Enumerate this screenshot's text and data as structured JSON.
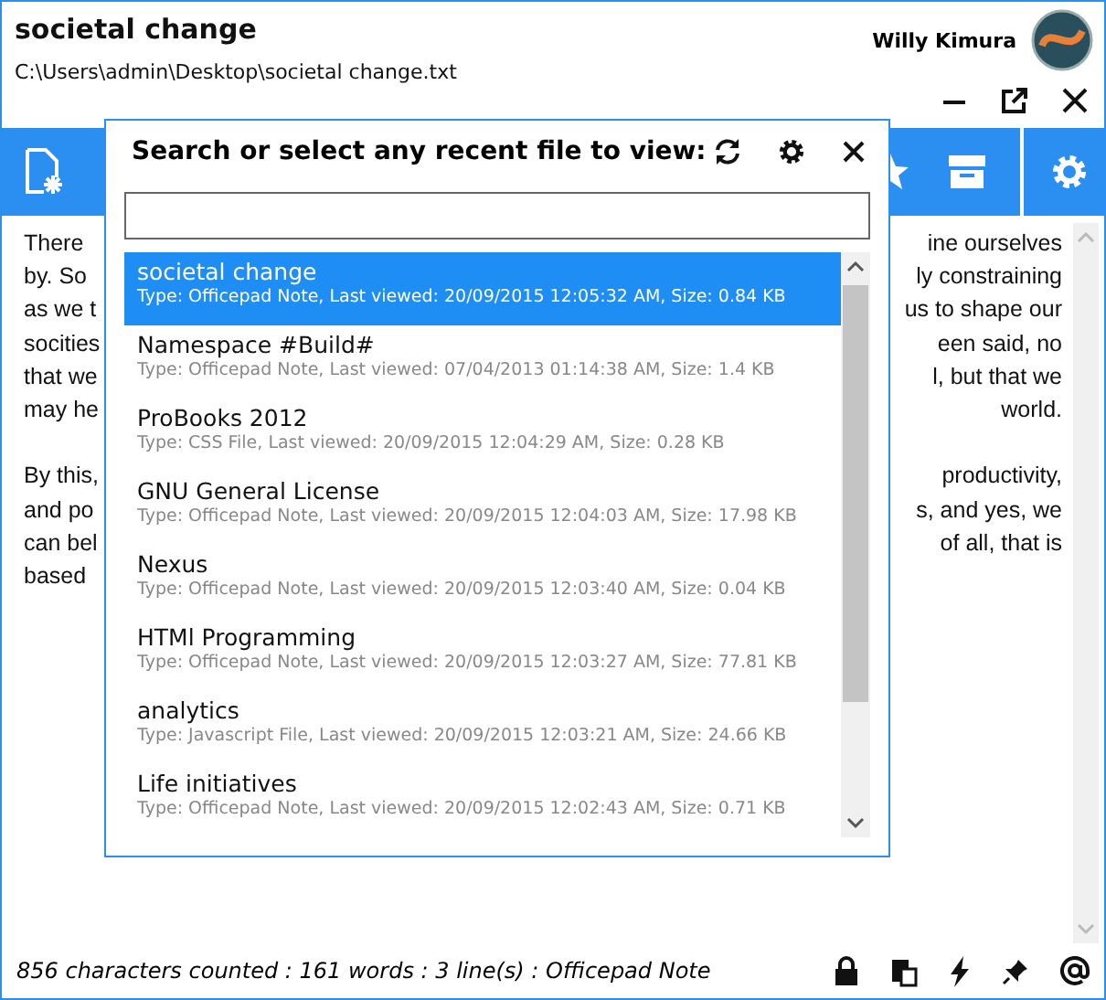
{
  "window": {
    "title": "societal change",
    "path": "C:\\Users\\admin\\Desktop\\societal change.txt",
    "user_name": "Willy Kimura"
  },
  "editor": {
    "paragraphs": [
      [
        {
          "left": "There",
          "right": "ine ourselves"
        },
        {
          "left": "by. So",
          "right": "ly constraining"
        },
        {
          "left": "as we t",
          "right": "us to shape our"
        },
        {
          "left": "socities",
          "right": "een said, no"
        },
        {
          "left": "that we",
          "right": "l, but that we"
        },
        {
          "left": "may he",
          "right": "world."
        }
      ],
      [
        {
          "left": "By this,",
          "right": "productivity,"
        },
        {
          "left": "and po",
          "right": "s, and yes, we"
        },
        {
          "left": "can bel",
          "right": "of all, that is"
        },
        {
          "left": "based"
        }
      ]
    ]
  },
  "dialog": {
    "title": "Search or select any recent file to view:",
    "files": [
      {
        "name": "societal change",
        "details": "Type: Officepad Note,  Last viewed: 20/09/2015 12:05:32 AM,  Size: 0.84 KB",
        "selected": true
      },
      {
        "name": "Namespace #Build#",
        "details": "Type: Officepad Note,  Last viewed: 07/04/2013 01:14:38 AM,  Size: 1.4 KB",
        "selected": false
      },
      {
        "name": "ProBooks 2012",
        "details": "Type: CSS File,  Last viewed: 20/09/2015 12:04:29 AM,  Size: 0.28 KB",
        "selected": false
      },
      {
        "name": "GNU General License",
        "details": "Type: Officepad Note,  Last viewed: 20/09/2015 12:04:03 AM,  Size: 17.98 KB",
        "selected": false
      },
      {
        "name": "Nexus",
        "details": "Type: Officepad Note,  Last viewed: 20/09/2015 12:03:40 AM,  Size: 0.04 KB",
        "selected": false
      },
      {
        "name": "HTMl Programming",
        "details": "Type: Officepad Note,  Last viewed: 20/09/2015 12:03:27 AM,  Size: 77.81 KB",
        "selected": false
      },
      {
        "name": "analytics",
        "details": "Type: Javascript File,  Last viewed: 20/09/2015 12:03:21 AM,  Size: 24.66 KB",
        "selected": false
      },
      {
        "name": "Life initiatives",
        "details": "Type: Officepad Note,  Last viewed: 20/09/2015 12:02:43 AM,  Size: 0.71 KB",
        "selected": false
      }
    ]
  },
  "status_bar": {
    "text": "856 characters counted : 161 words : 3 line(s) : Officepad Note"
  }
}
